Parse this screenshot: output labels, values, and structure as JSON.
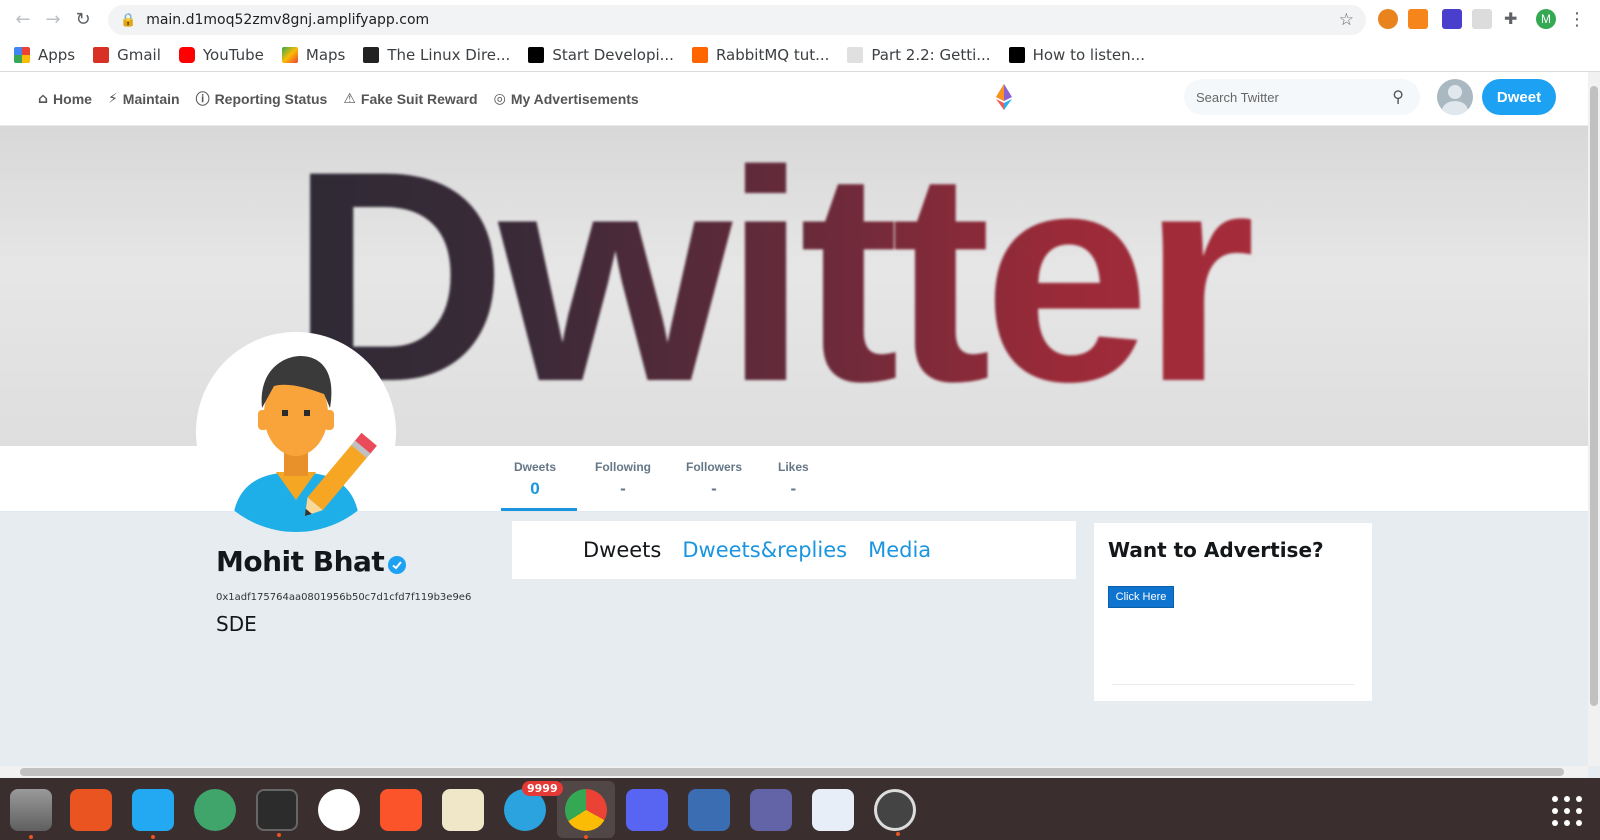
{
  "browser": {
    "url": "main.d1moq52zmv8gnj.amplifyapp.com",
    "bookmarks": [
      {
        "label": "Apps",
        "icon": "apps-grid-icon",
        "color": "#ea4335"
      },
      {
        "label": "Gmail",
        "icon": "gmail-icon",
        "color": "#d93025"
      },
      {
        "label": "YouTube",
        "icon": "youtube-icon",
        "color": "#ff0000"
      },
      {
        "label": "Maps",
        "icon": "maps-icon",
        "color": "#34a853"
      },
      {
        "label": "The Linux Dire...",
        "icon": "htg-icon",
        "color": "#222222"
      },
      {
        "label": "Start Developi...",
        "icon": "medium-icon",
        "color": "#000000"
      },
      {
        "label": "RabbitMQ tut...",
        "icon": "rabbitmq-icon",
        "color": "#ff6600"
      },
      {
        "label": "Part 2.2: Getti...",
        "icon": "page-icon",
        "color": "#9aa0a6"
      },
      {
        "label": "How to listen...",
        "icon": "medium-icon",
        "color": "#000000"
      }
    ],
    "profile_initial": "M"
  },
  "header": {
    "nav": [
      {
        "label": "Home",
        "icon": "home-icon",
        "glyph": "⌂"
      },
      {
        "label": "Maintain",
        "icon": "bolt-icon",
        "glyph": "⚡"
      },
      {
        "label": "Reporting Status",
        "icon": "info-icon",
        "glyph": "ⓘ"
      },
      {
        "label": "Fake Suit Reward",
        "icon": "warning-icon",
        "glyph": "⚠"
      },
      {
        "label": "My Advertisements",
        "icon": "broadcast-icon",
        "glyph": "◎"
      }
    ],
    "search_placeholder": "Search Twitter",
    "dweet_button": "Dweet"
  },
  "cover": {
    "text": "Dwitter"
  },
  "stats": [
    {
      "label": "Dweets",
      "value": "0"
    },
    {
      "label": "Following",
      "value": "-"
    },
    {
      "label": "Followers",
      "value": "-"
    },
    {
      "label": "Likes",
      "value": "-"
    }
  ],
  "profile": {
    "name": "Mohit Bhat",
    "wallet": "0x1adf175764aa0801956b50c7d1cfd7f119b3e9e6",
    "bio": "SDE"
  },
  "tabs": [
    {
      "label": "Dweets"
    },
    {
      "label": "Dweets&replies"
    },
    {
      "label": "Media"
    }
  ],
  "ad": {
    "title": "Want to Advertise?",
    "button": "Click Here"
  },
  "taskbar": {
    "telegram_badge": "9999",
    "apps": [
      "files-icon",
      "software-center-icon",
      "vscode-icon",
      "atom-icon",
      "terminal-icon",
      "slack-icon",
      "brave-icon",
      "text-editor-icon",
      "telegram-icon",
      "chrome-icon",
      "discord-icon",
      "remote-desktop-icon",
      "teams-icon",
      "image-viewer-icon",
      "software-updater-icon"
    ]
  },
  "colors": {
    "accent": "#1da1f2",
    "link": "#1b95e0",
    "ad_button": "#0e74d0"
  }
}
